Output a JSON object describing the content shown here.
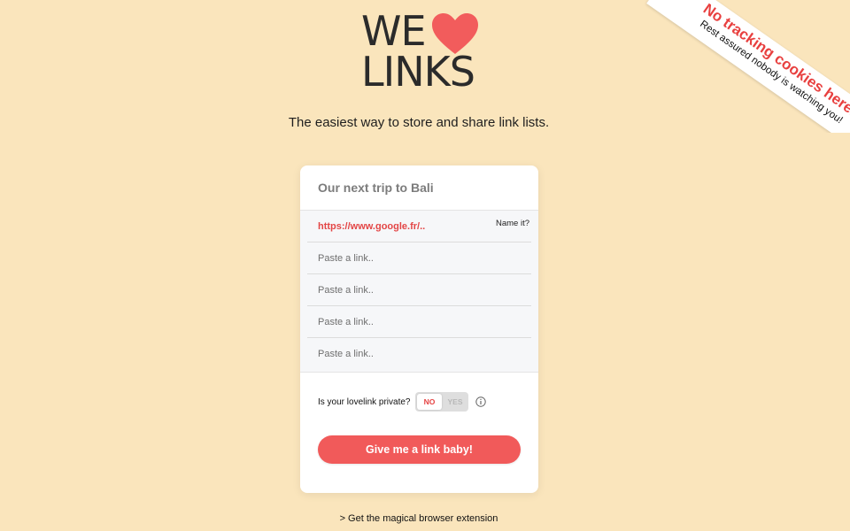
{
  "logo": {
    "line1": "WE",
    "line2": "LINKS",
    "heart_color": "#f25c5c"
  },
  "tagline": "The easiest way to store and share link lists.",
  "ribbon": {
    "title": "No tracking cookies here.",
    "subtitle": "Rest assured nobody is watching you!"
  },
  "card": {
    "title": "Our next trip to Bali",
    "links": [
      {
        "value": "https://www.google.fr/..",
        "placeholder": "Paste a link..",
        "name_label": "Name it?"
      },
      {
        "value": "",
        "placeholder": "Paste a link.."
      },
      {
        "value": "",
        "placeholder": "Paste a link.."
      },
      {
        "value": "",
        "placeholder": "Paste a link.."
      },
      {
        "value": "",
        "placeholder": "Paste a link.."
      }
    ],
    "private": {
      "label": "Is your lovelink private?",
      "no": "NO",
      "yes": "YES",
      "selected": "NO"
    },
    "submit_label": "Give me a link baby!"
  },
  "extension_link": "> Get the magical browser extension",
  "colors": {
    "background": "#fae5bc",
    "accent": "#f15a5a",
    "link_text": "#e34646"
  },
  "icons": {
    "heart": "heart-icon",
    "info": "info-icon"
  }
}
